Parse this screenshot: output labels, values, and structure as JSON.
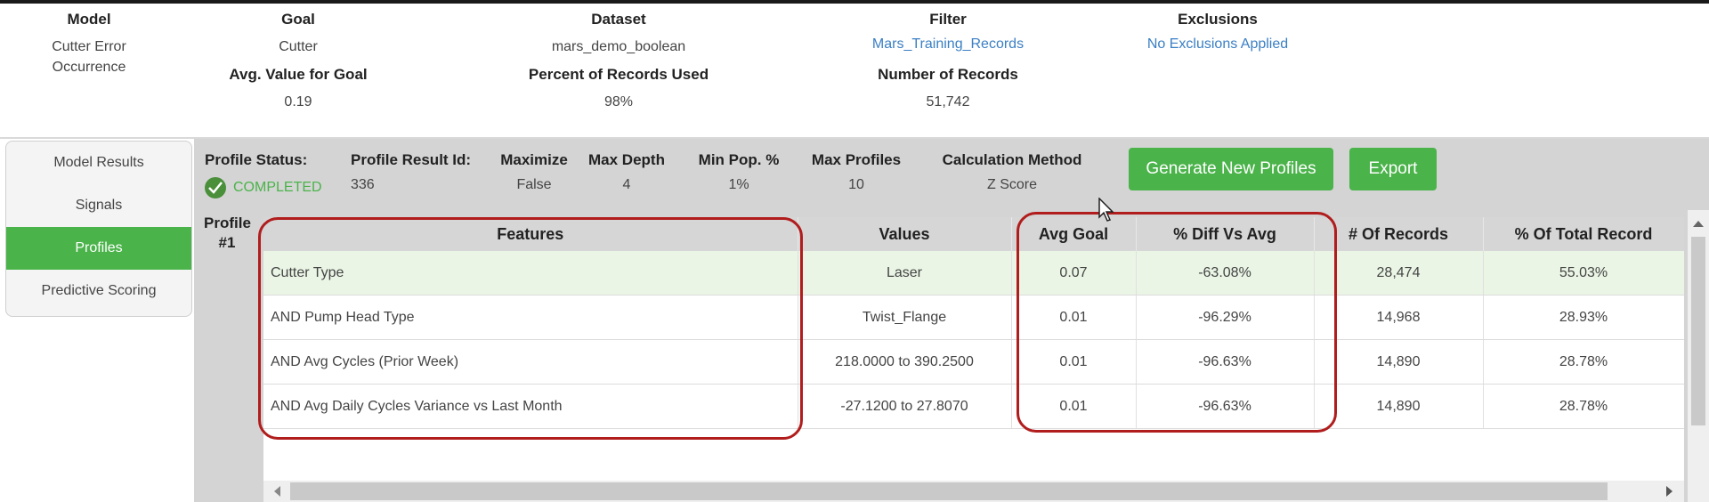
{
  "summary": {
    "model": {
      "label": "Model",
      "value_line1": "Cutter Error",
      "value_line2": "Occurrence"
    },
    "goal": {
      "label": "Goal",
      "value": "Cutter"
    },
    "dataset": {
      "label": "Dataset",
      "value": "mars_demo_boolean"
    },
    "filter": {
      "label": "Filter",
      "value": "Mars_Training_Records"
    },
    "exclusions": {
      "label": "Exclusions",
      "value": "No Exclusions Applied"
    },
    "avg_value": {
      "label": "Avg. Value for Goal",
      "value": "0.19"
    },
    "percent_used": {
      "label": "Percent of Records Used",
      "value": "98%"
    },
    "num_records": {
      "label": "Number of Records",
      "value": "51,742"
    }
  },
  "nav": {
    "items": [
      {
        "label": "Model Results"
      },
      {
        "label": "Signals"
      },
      {
        "label": "Profiles"
      },
      {
        "label": "Predictive Scoring"
      }
    ]
  },
  "profile_info": {
    "status_label": "Profile Status:",
    "status_value": "COMPLETED",
    "result_id_label": "Profile Result Id:",
    "result_id_value": "336",
    "maximize_label": "Maximize",
    "maximize_value": "False",
    "max_depth_label": "Max Depth",
    "max_depth_value": "4",
    "min_pop_label": "Min Pop. %",
    "min_pop_value": "1%",
    "max_profiles_label": "Max Profiles",
    "max_profiles_value": "10",
    "calc_method_label": "Calculation Method",
    "calc_method_value": "Z Score"
  },
  "buttons": {
    "generate": "Generate New Profiles",
    "export": "Export"
  },
  "profile_label_line1": "Profile",
  "profile_label_line2": "#1",
  "table": {
    "headers": [
      "Features",
      "Values",
      "Avg Goal",
      "% Diff Vs Avg",
      "# Of Records",
      "% Of Total Record"
    ],
    "rows": [
      {
        "feature": "Cutter Type",
        "value": "Laser",
        "avg_goal": "0.07",
        "diff": "-63.08%",
        "records": "28,474",
        "pct_total": "55.03%"
      },
      {
        "feature": "AND Pump Head Type",
        "value": "Twist_Flange",
        "avg_goal": "0.01",
        "diff": "-96.29%",
        "records": "14,968",
        "pct_total": "28.93%"
      },
      {
        "feature": "AND Avg Cycles (Prior Week)",
        "value": "218.0000 to 390.2500",
        "avg_goal": "0.01",
        "diff": "-96.63%",
        "records": "14,890",
        "pct_total": "28.78%"
      },
      {
        "feature": "AND Avg Daily Cycles Variance vs Last Month",
        "value": "-27.1200 to 27.8070",
        "avg_goal": "0.01",
        "diff": "-96.63%",
        "records": "14,890",
        "pct_total": "28.78%"
      }
    ]
  },
  "colors": {
    "accent": "#4ab34a",
    "link": "#3a7fc4",
    "highlight": "#b11d1d"
  },
  "icons": {
    "status": "check-circle-icon",
    "cursor": "mouse-pointer-icon"
  }
}
